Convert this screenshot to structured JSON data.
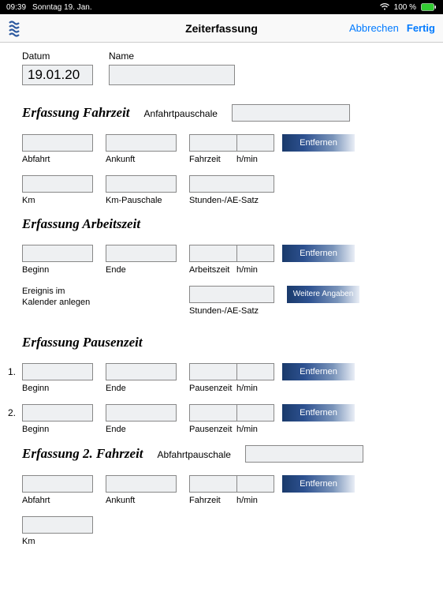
{
  "status": {
    "time": "09:39",
    "date": "Sonntag 19. Jan.",
    "battery_pct": "100 %",
    "battery_badge": "⚡"
  },
  "nav": {
    "title": "Zeiterfassung",
    "cancel": "Abbrechen",
    "done": "Fertig"
  },
  "top": {
    "datum_label": "Datum",
    "datum_value": "19.01.20",
    "name_label": "Name",
    "name_value": ""
  },
  "sections": {
    "fahrzeit": {
      "title": "Erfassung Fahrzeit",
      "extra_label": "Anfahrtpauschale",
      "row1": {
        "abfahrt": "Abfahrt",
        "ankunft": "Ankunft",
        "fahrzeit": "Fahrzeit",
        "hmin": "h/min",
        "remove": "Entfernen"
      },
      "row2": {
        "km": "Km",
        "kmpauschale": "Km-Pauschale",
        "satz": "Stunden-/AE-Satz"
      }
    },
    "arbeitszeit": {
      "title": "Erfassung Arbeitszeit",
      "row1": {
        "beginn": "Beginn",
        "ende": "Ende",
        "arbeitszeit": "Arbeitszeit",
        "hmin": "h/min",
        "remove": "Entfernen"
      },
      "row2": {
        "calendar_note": "Ereignis im Kalender anlegen",
        "satz": "Stunden-/AE-Satz",
        "weitere": "Weitere Angaben"
      }
    },
    "pausenzeit": {
      "title": "Erfassung Pausenzeit",
      "rows": [
        {
          "num": "1.",
          "beginn": "Beginn",
          "ende": "Ende",
          "pausenzeit": "Pausenzeit",
          "hmin": "h/min",
          "remove": "Entfernen"
        },
        {
          "num": "2.",
          "beginn": "Beginn",
          "ende": "Ende",
          "pausenzeit": "Pausenzeit",
          "hmin": "h/min",
          "remove": "Entfernen"
        }
      ]
    },
    "fahrzeit2": {
      "title": "Erfassung 2. Fahrzeit",
      "extra_label": "Abfahrtpauschale",
      "row1": {
        "abfahrt": "Abfahrt",
        "ankunft": "Ankunft",
        "fahrzeit": "Fahrzeit",
        "hmin": "h/min",
        "remove": "Entfernen"
      },
      "row2": {
        "km": "Km"
      }
    }
  }
}
